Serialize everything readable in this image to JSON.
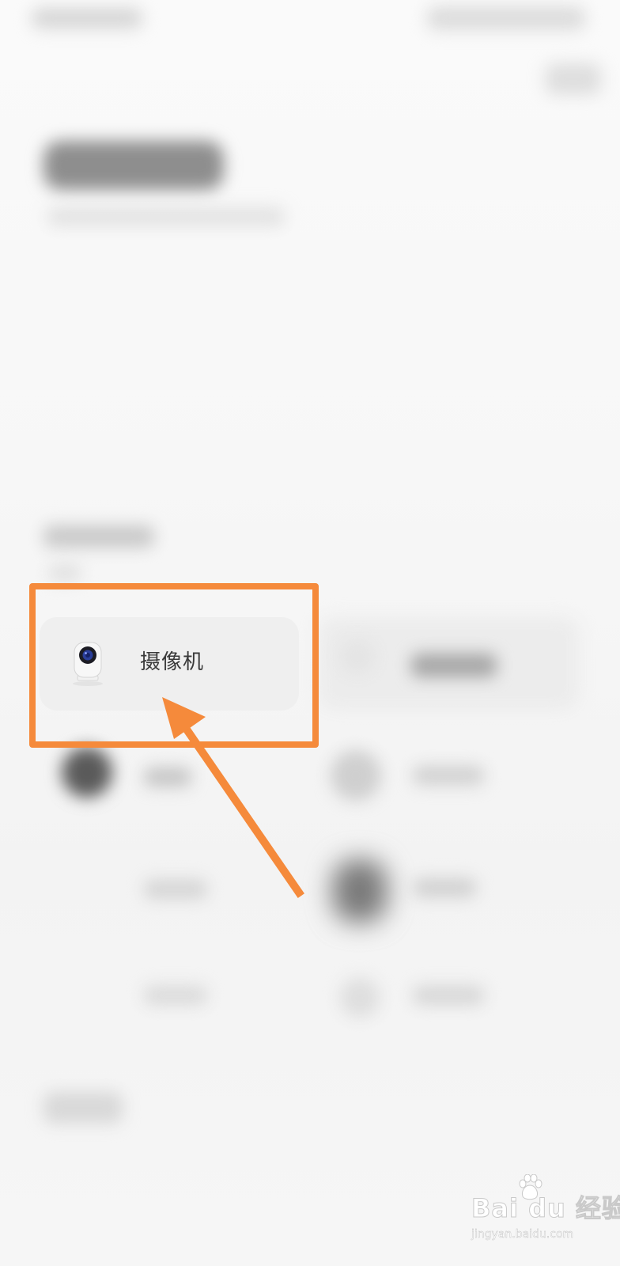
{
  "device_list": {
    "camera_item": {
      "label": "摄像机",
      "icon": "camera-icon"
    }
  },
  "annotation": {
    "highlight_color": "#f58a3b",
    "arrow_color": "#f58a3b"
  },
  "watermark": {
    "logo_text": "Bai  du 经验",
    "url": "jingyan.baidu.com"
  }
}
